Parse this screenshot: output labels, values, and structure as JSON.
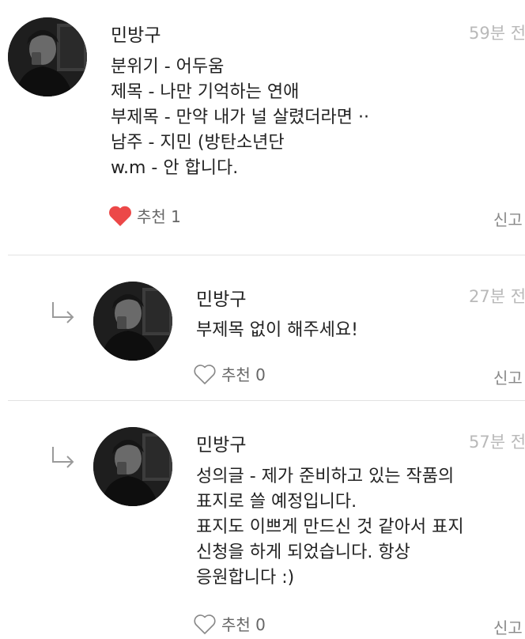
{
  "comments": [
    {
      "author": "민방구",
      "time": "59분 전",
      "lines": [
        "분위기 - 어두움",
        "제목 - 나만 기억하는 연애",
        "부제목 - 만약 내가 널 살렸더라면 ··",
        "남주 - 지민 (방탄소년단",
        "w.m - 안 합니다."
      ],
      "likes_label": "추천 1",
      "liked": true,
      "report_label": "신고"
    },
    {
      "author": "민방구",
      "time": "27분 전",
      "lines": [
        "부제목 없이 해주세요!"
      ],
      "likes_label": "추천 0",
      "liked": false,
      "report_label": "신고"
    },
    {
      "author": "민방구",
      "time": "57분 전",
      "lines": [
        "성의글 - 제가 준비하고 있는 작품의",
        "표지로 쓸 예정입니다.",
        "표지도 이쁘게 만드신 것 같아서 표지",
        "신청을 하게 되었습니다. 항상",
        "응원합니다 :)"
      ],
      "likes_label": "추천 0",
      "liked": false,
      "report_label": "신고"
    }
  ],
  "colors": {
    "heart_liked": "#ec4848",
    "heart_outline": "#888888",
    "time": "#b9b9b9",
    "divider": "#e2e2e2"
  },
  "icons": {
    "reply": "reply-arrow-icon",
    "like": "heart-icon",
    "avatar": "profile-photo"
  }
}
